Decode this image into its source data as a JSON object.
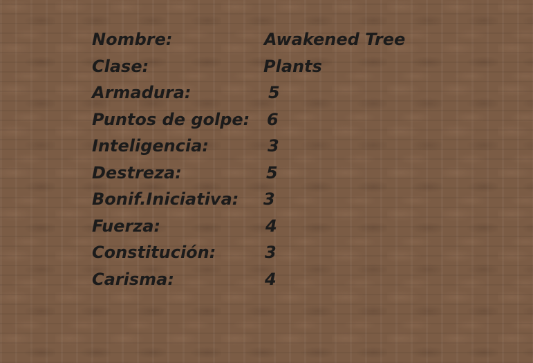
{
  "stats": [
    {
      "label": "Nombre:",
      "value": "Awakened Tree"
    },
    {
      "label": "Clase:",
      "value": "Plants"
    },
    {
      "label": "Armadura:",
      "value": "5"
    },
    {
      "label": "Puntos de golpe:",
      "value": "6"
    },
    {
      "label": "Inteligencia:",
      "value": "3"
    },
    {
      "label": "Destreza:",
      "value": "5"
    },
    {
      "label": "Bonif.Iniciativa:",
      "value": "3"
    },
    {
      "label": "Fuerza:",
      "value": "4"
    },
    {
      "label": "Constitución:",
      "value": "3"
    },
    {
      "label": "Carisma:",
      "value": "4"
    }
  ],
  "colors": {
    "background": "#7b5c45",
    "text": "#1b1b1b"
  }
}
